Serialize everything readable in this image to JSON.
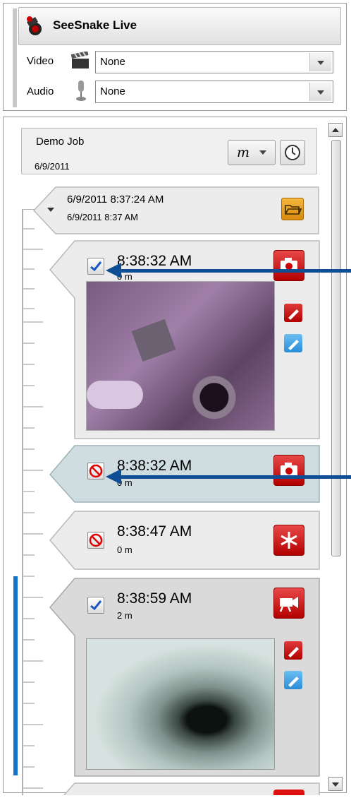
{
  "header": {
    "title": "SeeSnake Live",
    "video_label": "Video",
    "video_value": "None",
    "audio_label": "Audio",
    "audio_value": "None"
  },
  "job": {
    "name": "Demo Job",
    "date": "6/9/2011",
    "unit": "m"
  },
  "session": {
    "start": "6/9/2011 8:37:24 AM",
    "start_short": "6/9/2011 8:37 AM"
  },
  "entries": [
    {
      "time": "8:38:32 AM",
      "distance": "0 m",
      "type": "photo",
      "status": "checked"
    },
    {
      "time": "8:38:32 AM",
      "distance": "0 m",
      "type": "photo",
      "status": "excluded"
    },
    {
      "time": "8:38:47 AM",
      "distance": "0 m",
      "type": "marker",
      "status": "excluded"
    },
    {
      "time": "8:38:59 AM",
      "distance": "2 m",
      "type": "video",
      "status": "checked"
    }
  ],
  "colors": {
    "accent_blue": "#0d4e94",
    "timeline_blue": "#1473c9",
    "red_button": "#c40000",
    "selected_bg": "#cfdde1"
  }
}
